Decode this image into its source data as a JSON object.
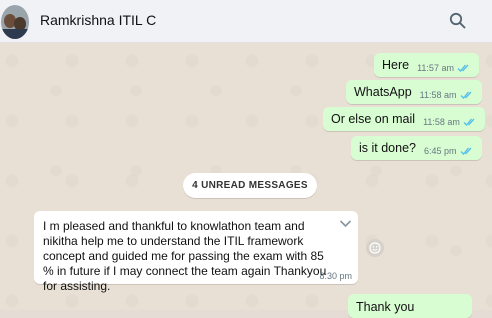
{
  "header": {
    "contact_name": "Ramkrishna ITIL C",
    "avatar_icon": "contact-photo",
    "search_icon": "search-icon"
  },
  "messages_out": [
    {
      "text": "Here",
      "time": "11:57 am",
      "status": "read"
    },
    {
      "text": "WhatsApp",
      "time": "11:58 am",
      "status": "read"
    },
    {
      "text": "Or else on mail",
      "time": "11:58 am",
      "status": "read"
    },
    {
      "text": "is it done?",
      "time": "6:45 pm",
      "status": "read"
    },
    {
      "text": "Thank you",
      "time": "",
      "status": "read"
    }
  ],
  "unread_label": "4 UNREAD MESSAGES",
  "message_in": {
    "text": "I m pleased and thankful to knowlathon team and nikitha help me to understand the ITIL framework concept and guided me for passing the exam with 85 % in future if I may connect the team again Thankyou for assisting.",
    "time": "8:30 pm"
  },
  "colors": {
    "outgoing_bubble": "#d9fdd3",
    "incoming_bubble": "#ffffff",
    "read_ticks": "#53bdeb",
    "chat_background": "#e9e0d5"
  }
}
